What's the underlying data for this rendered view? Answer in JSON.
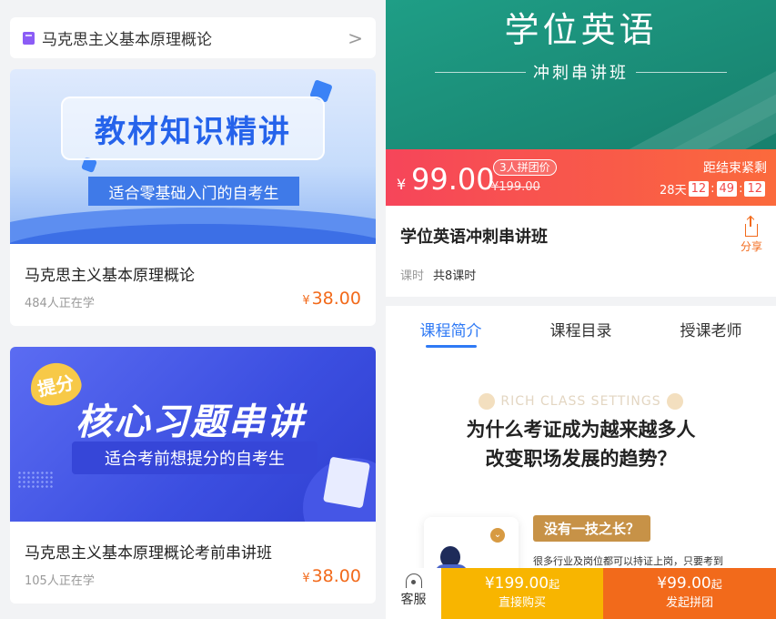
{
  "left": {
    "subject_selector": {
      "label": "马克思主义基本原理概论",
      "chevron": ">"
    },
    "cards": [
      {
        "banner": {
          "headline": "教材知识精讲",
          "tagline": "适合零基础入门的自考生"
        },
        "title": "马克思主义基本原理概论",
        "learners": "484人正在学",
        "currency": "¥",
        "price": "38.00"
      },
      {
        "banner": {
          "badge": "提分",
          "headline": "核心习题串讲",
          "tagline": "适合考前想提分的自考生"
        },
        "title": "马克思主义基本原理概论考前串讲班",
        "learners": "105人正在学",
        "currency": "¥",
        "price": "38.00"
      }
    ]
  },
  "right": {
    "hero": {
      "title": "学位英语",
      "subtitle": "冲刺串讲班"
    },
    "pricebar": {
      "currency": "¥",
      "price": "99.00",
      "badge": "3人拼团价",
      "original_price": "¥199.00",
      "countdown_label": "距结束紧剩",
      "days": "28天",
      "hours": "12",
      "minutes": "49",
      "seconds": "12",
      "sep": ":"
    },
    "course": {
      "name": "学位英语冲刺串讲班",
      "share_label": "分享",
      "lessons_key": "课时",
      "lessons_value": "共8课时"
    },
    "tabs": [
      "课程简介",
      "课程目录",
      "授课老师"
    ],
    "active_tab": 0,
    "content": {
      "decor_text": "RICH CLASS SETTINGS",
      "headline_line1": "为什么考证成为越来越多人",
      "headline_line2": "改变职场发展的趋势？",
      "slogan": "没有一技之长？",
      "desc": "很多行业及岗位都可以持证上岗，只要考到"
    },
    "bottom_bar": {
      "service_label": "客服",
      "buy_price": "¥199.00",
      "buy_suffix": "起",
      "buy_label": "直接购买",
      "group_price": "¥99.00",
      "group_suffix": "起",
      "group_label": "发起拼团"
    }
  },
  "colors": {
    "accent_orange": "#f26a1b",
    "tab_active_blue": "#2f7af5",
    "hero_green": "#1f9e86",
    "buy_yellow": "#f8b500"
  }
}
